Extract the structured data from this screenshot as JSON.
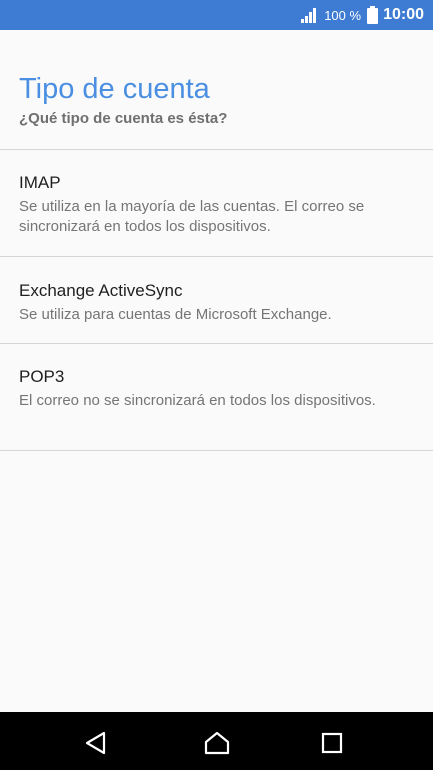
{
  "status_bar": {
    "battery_percent": "100 %",
    "time": "10:00",
    "color": "#3e7bd3"
  },
  "header": {
    "title": "Tipo de cuenta",
    "subtitle": "¿Qué tipo de cuenta es ésta?"
  },
  "options": [
    {
      "title": "IMAP",
      "description": "Se utiliza en la mayoría de las cuentas. El correo se sincronizará en todos los dispositivos."
    },
    {
      "title": "Exchange ActiveSync",
      "description": "Se utiliza para cuentas de Microsoft Exchange."
    },
    {
      "title": "POP3",
      "description": "El correo no se sincronizará en todos los dispositivos."
    }
  ],
  "icons": {
    "signal": "signal-icon",
    "battery": "battery-icon",
    "back": "back-icon",
    "home": "home-icon",
    "recents": "recents-icon"
  },
  "accent_color": "#4b8fe2"
}
